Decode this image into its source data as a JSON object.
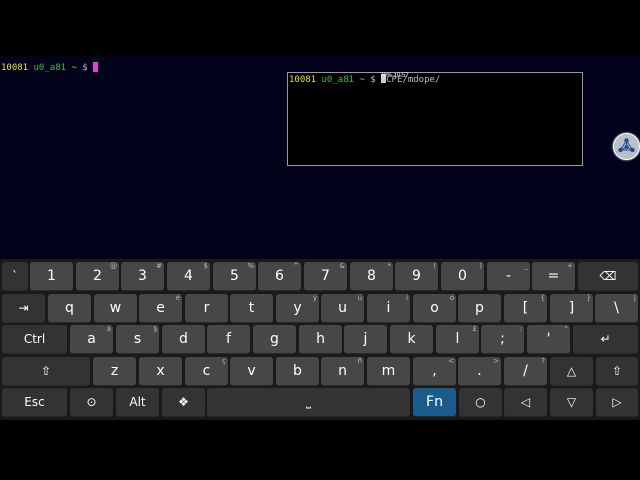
{
  "terminal": {
    "prompt_num": "10081",
    "prompt_user": "u0_a81",
    "prompt_tilde": "~",
    "prompt_dollar": "$"
  },
  "popup": {
    "prompt_num": "10081",
    "prompt_user": "u0_a81",
    "prompt_rest": "~ $",
    "command": "CPE/mdope/",
    "overlay": "70% 10:57"
  },
  "keyboard": {
    "row1": [
      {
        "label": "`",
        "sup": ""
      },
      {
        "label": "1",
        "sup": ""
      },
      {
        "label": "2",
        "sup": "@"
      },
      {
        "label": "3",
        "sup": "#"
      },
      {
        "label": "4",
        "sup": "$"
      },
      {
        "label": "5",
        "sup": "%"
      },
      {
        "label": "6",
        "sup": "^"
      },
      {
        "label": "7",
        "sup": "&"
      },
      {
        "label": "8",
        "sup": "*"
      },
      {
        "label": "9",
        "sup": "("
      },
      {
        "label": "0",
        "sup": ")"
      },
      {
        "label": "-",
        "sup": "_"
      },
      {
        "label": "=",
        "sup": "+"
      },
      {
        "label": "⌫",
        "sup": ""
      }
    ],
    "row2": [
      {
        "label": "⇥",
        "sup": ""
      },
      {
        "label": "q",
        "sup": ""
      },
      {
        "label": "w",
        "sup": ""
      },
      {
        "label": "e",
        "sup": "é"
      },
      {
        "label": "r",
        "sup": ""
      },
      {
        "label": "t",
        "sup": ""
      },
      {
        "label": "y",
        "sup": "ý"
      },
      {
        "label": "u",
        "sup": "ú"
      },
      {
        "label": "i",
        "sup": "í"
      },
      {
        "label": "o",
        "sup": "ó"
      },
      {
        "label": "p",
        "sup": ""
      },
      {
        "label": "[",
        "sup": "{"
      },
      {
        "label": "]",
        "sup": "}"
      },
      {
        "label": "\\",
        "sup": "|"
      }
    ],
    "row3": [
      {
        "label": "Ctrl",
        "sup": ""
      },
      {
        "label": "a",
        "sup": "á"
      },
      {
        "label": "s",
        "sup": "§"
      },
      {
        "label": "d",
        "sup": ""
      },
      {
        "label": "f",
        "sup": ""
      },
      {
        "label": "g",
        "sup": ""
      },
      {
        "label": "h",
        "sup": ""
      },
      {
        "label": "j",
        "sup": ""
      },
      {
        "label": "k",
        "sup": ""
      },
      {
        "label": "l",
        "sup": "£"
      },
      {
        "label": ";",
        "sup": ":"
      },
      {
        "label": "'",
        "sup": "\""
      },
      {
        "label": "↵",
        "sup": ""
      }
    ],
    "row4": [
      {
        "label": "⇧",
        "sup": ""
      },
      {
        "label": "z",
        "sup": ""
      },
      {
        "label": "x",
        "sup": ""
      },
      {
        "label": "c",
        "sup": "ç"
      },
      {
        "label": "v",
        "sup": ""
      },
      {
        "label": "b",
        "sup": ""
      },
      {
        "label": "n",
        "sup": "ñ"
      },
      {
        "label": "m",
        "sup": ""
      },
      {
        "label": ",",
        "sup": "<"
      },
      {
        "label": ".",
        "sup": ">"
      },
      {
        "label": "/",
        "sup": "?"
      },
      {
        "label": "△",
        "sup": ""
      },
      {
        "label": "⇧",
        "sup": ""
      }
    ],
    "row5": [
      {
        "label": "Esc",
        "sup": ""
      },
      {
        "label": "⊙",
        "sup": ""
      },
      {
        "label": "Alt",
        "sup": ""
      },
      {
        "label": "❖",
        "sup": ""
      },
      {
        "label": "⎵",
        "sup": ""
      },
      {
        "label": "Fn",
        "sup": ""
      },
      {
        "label": "○",
        "sup": ""
      },
      {
        "label": "◁",
        "sup": ""
      },
      {
        "label": "▽",
        "sup": ""
      },
      {
        "label": "▷",
        "sup": ""
      }
    ]
  },
  "colors": {
    "key": "#474747",
    "key_dark": "#333333",
    "fn_key": "#1b5c8c",
    "terminal_bg": "#02021a"
  }
}
